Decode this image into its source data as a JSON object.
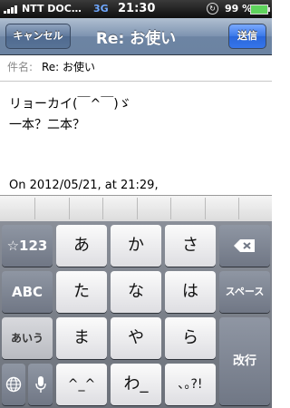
{
  "status": {
    "carrier": "NTT DOC…",
    "network": "3G",
    "time": "21:30",
    "battery": "99 %",
    "battery_level": 0.99
  },
  "nav": {
    "cancel": "キャンセル",
    "title": "Re: お使い",
    "send": "送信"
  },
  "compose": {
    "subject_label": "件名:",
    "subject_value": "Re: お使い",
    "body_lines": [
      "リョーカイ(￣^￣)ゞ",
      "一本？二本？"
    ],
    "quote_line": "On 2012/05/21, at 21:29,"
  },
  "keyboard": {
    "keys": {
      "symbol": "☆123",
      "a": "あ",
      "ka": "か",
      "sa": "さ",
      "abc": "ABC",
      "ta": "た",
      "na": "な",
      "ha": "は",
      "space": "スペース",
      "aiu": "あいう",
      "ma": "ま",
      "ya": "や",
      "ra": "ら",
      "newline": "改行",
      "kaomoji": "^_^",
      "wa": "わ_",
      "punct": "､｡?!"
    },
    "icons": {
      "delete": "backspace-icon",
      "globe": "globe-icon",
      "mic": "microphone-icon"
    }
  }
}
